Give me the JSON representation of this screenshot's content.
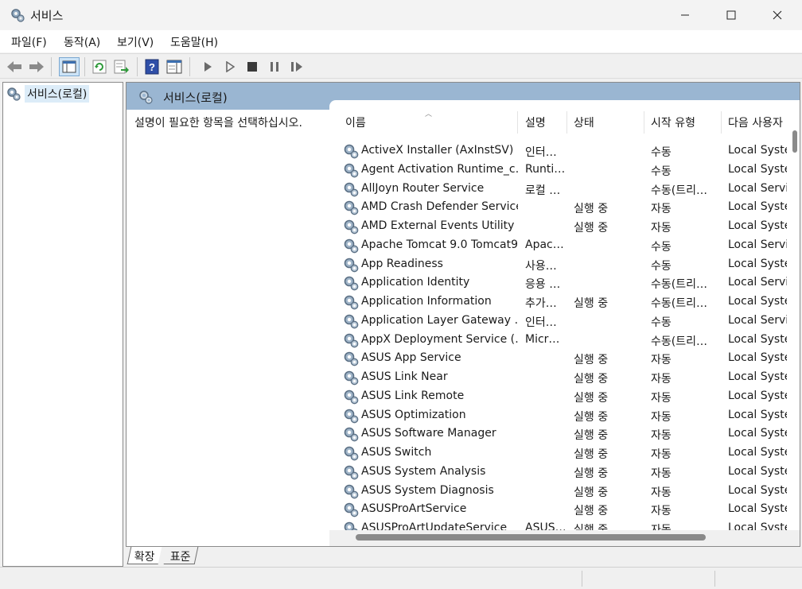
{
  "window": {
    "title": "서비스",
    "icon": "gear-icon"
  },
  "menu": [
    "파일(F)",
    "동작(A)",
    "보기(V)",
    "도움말(H)"
  ],
  "toolbar": {
    "icons": [
      "back-arrow-icon",
      "forward-arrow-icon",
      "console-tree-icon",
      "refresh-icon",
      "export-list-icon",
      "help-icon",
      "properties-pane-icon",
      "start-service-icon",
      "start-service-alt-icon",
      "stop-service-icon",
      "pause-service-icon",
      "resume-service-icon"
    ]
  },
  "tree": {
    "root_label": "서비스(로컬)"
  },
  "pane": {
    "header": "서비스(로컬)",
    "description": "설명이 필요한 항목을 선택하십시오."
  },
  "columns": [
    "이름",
    "설명",
    "상태",
    "시작 유형",
    "다음 사용자"
  ],
  "services": [
    {
      "name": "ActiveX Installer (AxInstSV)",
      "desc": "인터…",
      "state": "",
      "start": "수동",
      "logon": "Local Syste"
    },
    {
      "name": "Agent Activation Runtime_c…",
      "desc": "Runti…",
      "state": "",
      "start": "수동",
      "logon": "Local Syste"
    },
    {
      "name": "AllJoyn Router Service",
      "desc": "로컬 …",
      "state": "",
      "start": "수동(트리…",
      "logon": "Local Servi"
    },
    {
      "name": "AMD Crash Defender Service",
      "desc": "",
      "state": "실행 중",
      "start": "자동",
      "logon": "Local Syste"
    },
    {
      "name": "AMD External Events Utility",
      "desc": "",
      "state": "실행 중",
      "start": "자동",
      "logon": "Local Syste"
    },
    {
      "name": "Apache Tomcat 9.0 Tomcat9",
      "desc": "Apac…",
      "state": "",
      "start": "수동",
      "logon": "Local Servi"
    },
    {
      "name": "App Readiness",
      "desc": "사용…",
      "state": "",
      "start": "수동",
      "logon": "Local Syste"
    },
    {
      "name": "Application Identity",
      "desc": "응용 …",
      "state": "",
      "start": "수동(트리…",
      "logon": "Local Servi"
    },
    {
      "name": "Application Information",
      "desc": "추가…",
      "state": "실행 중",
      "start": "수동(트리…",
      "logon": "Local Syste"
    },
    {
      "name": "Application Layer Gateway …",
      "desc": "인터…",
      "state": "",
      "start": "수동",
      "logon": "Local Servi"
    },
    {
      "name": "AppX Deployment Service (…",
      "desc": "Micr…",
      "state": "",
      "start": "수동(트리…",
      "logon": "Local Syste"
    },
    {
      "name": "ASUS App Service",
      "desc": "",
      "state": "실행 중",
      "start": "자동",
      "logon": "Local Syste"
    },
    {
      "name": "ASUS Link Near",
      "desc": "",
      "state": "실행 중",
      "start": "자동",
      "logon": "Local Syste"
    },
    {
      "name": "ASUS Link Remote",
      "desc": "",
      "state": "실행 중",
      "start": "자동",
      "logon": "Local Syste"
    },
    {
      "name": "ASUS Optimization",
      "desc": "",
      "state": "실행 중",
      "start": "자동",
      "logon": "Local Syste"
    },
    {
      "name": "ASUS Software Manager",
      "desc": "",
      "state": "실행 중",
      "start": "자동",
      "logon": "Local Syste"
    },
    {
      "name": "ASUS Switch",
      "desc": "",
      "state": "실행 중",
      "start": "자동",
      "logon": "Local Syste"
    },
    {
      "name": "ASUS System Analysis",
      "desc": "",
      "state": "실행 중",
      "start": "자동",
      "logon": "Local Syste"
    },
    {
      "name": "ASUS System Diagnosis",
      "desc": "",
      "state": "실행 중",
      "start": "자동",
      "logon": "Local Syste"
    },
    {
      "name": "ASUSProArtService",
      "desc": "",
      "state": "실행 중",
      "start": "자동",
      "logon": "Local Syste"
    },
    {
      "name": "ASUSProArtUpdateService",
      "desc": "ASUS…",
      "state": "실행 중",
      "start": "자동",
      "logon": "Local Syste"
    }
  ],
  "tabs": [
    "확장",
    "표준"
  ],
  "colors": {
    "header_band": "#9ab6d2",
    "selection": "#dcecf8"
  }
}
